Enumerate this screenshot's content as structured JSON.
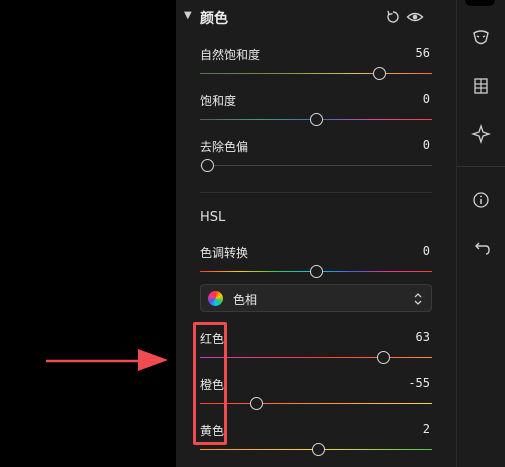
{
  "section": {
    "title": "颜色",
    "reset_icon": "reset-icon",
    "visibility_icon": "eye-icon"
  },
  "sliders": {
    "vibrance": {
      "label": "自然饱和度",
      "value": "56",
      "position": 0.77
    },
    "saturation": {
      "label": "饱和度",
      "value": "0",
      "position": 0.5
    },
    "remove_cast": {
      "label": "去除色偏",
      "value": "0",
      "position": 0.03
    }
  },
  "hsl": {
    "heading": "HSL",
    "hue_shift": {
      "label": "色调转换",
      "value": "0",
      "position": 0.5
    },
    "mode_select": {
      "value": "色相",
      "icon": "color-wheel-icon"
    },
    "channels": [
      {
        "label": "红色",
        "value": "63",
        "position": 0.79
      },
      {
        "label": "橙色",
        "value": "-55",
        "position": 0.24
      },
      {
        "label": "黄色",
        "value": "2",
        "position": 0.51
      }
    ]
  },
  "right_toolbar": {
    "icons": [
      "mask-icon",
      "grid-icon",
      "sparkle-icon",
      "info-icon",
      "undo-icon"
    ]
  },
  "colors": {
    "panel_bg": "#1c1c1c",
    "annotation_red": "#ef4b50"
  }
}
